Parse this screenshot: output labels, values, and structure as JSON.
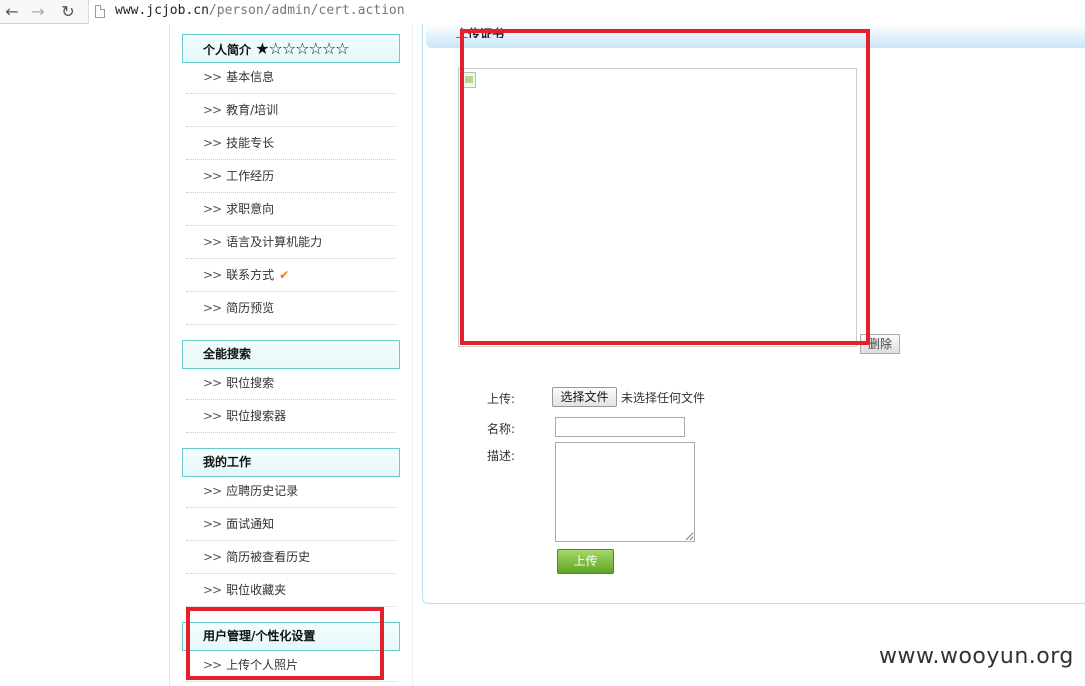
{
  "browser": {
    "url_host": "www.jcjob.cn",
    "url_path": "/person/admin/cert.action"
  },
  "sidebar": {
    "sections": [
      {
        "title": "个人简介",
        "stars": "★☆☆☆☆☆☆",
        "items": [
          {
            "label": "基本信息"
          },
          {
            "label": "教育/培训"
          },
          {
            "label": "技能专长"
          },
          {
            "label": "工作经历"
          },
          {
            "label": "求职意向"
          },
          {
            "label": "语言及计算机能力"
          },
          {
            "label": "联系方式",
            "check": "✔"
          },
          {
            "label": "简历预览"
          }
        ]
      },
      {
        "title": "全能搜索",
        "items": [
          {
            "label": "职位搜索"
          },
          {
            "label": "职位搜索器"
          }
        ]
      },
      {
        "title": "我的工作",
        "items": [
          {
            "label": "应聘历史记录"
          },
          {
            "label": "面试通知"
          },
          {
            "label": "简历被查看历史"
          },
          {
            "label": "职位收藏夹"
          }
        ]
      },
      {
        "title": "用户管理/个性化设置",
        "items": [
          {
            "label": "上传个人照片"
          }
        ]
      }
    ],
    "arrow": ">>"
  },
  "main": {
    "title": "上传证书",
    "delete_label": "删除",
    "upload_label": "上传:",
    "choose_file_label": "选择文件",
    "no_file_text": "未选择任何文件",
    "name_label": "名称:",
    "desc_label": "描述:",
    "submit_label": "上传"
  },
  "watermark": "www.wooyun.org",
  "colors": {
    "annotation_red": "#e3202b",
    "section_border": "#66cccc",
    "check_orange": "#f07800",
    "upload_green": "#5ea524"
  }
}
